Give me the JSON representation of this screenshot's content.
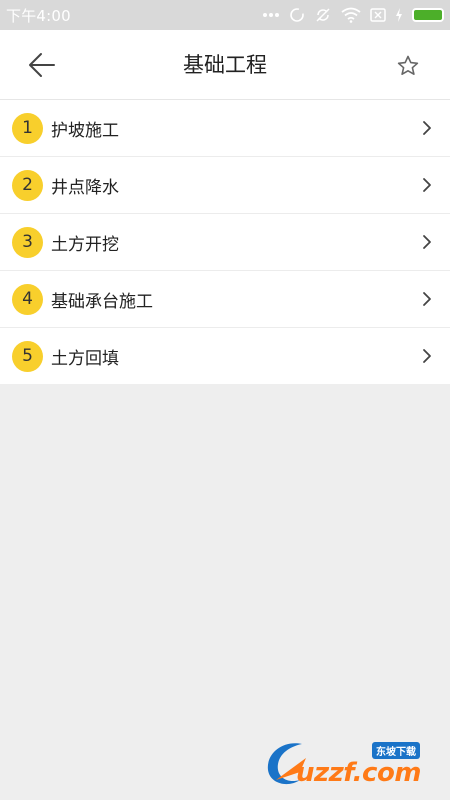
{
  "status_bar": {
    "time": "下午4:00"
  },
  "header": {
    "title": "基础工程",
    "back_icon": "arrow-left-icon",
    "favorite_icon": "star-outline-icon"
  },
  "list": {
    "items": [
      {
        "number": "1",
        "label": "护坡施工"
      },
      {
        "number": "2",
        "label": "井点降水"
      },
      {
        "number": "3",
        "label": "土方开挖"
      },
      {
        "number": "4",
        "label": "基础承台施工"
      },
      {
        "number": "5",
        "label": "土方回填"
      }
    ]
  },
  "watermark": {
    "text": "uzzf.com",
    "sub": "东坡下载"
  },
  "colors": {
    "badge": "#f8cf2c",
    "status_bar_bg": "#d9d9d9",
    "battery": "#4caf29",
    "page_bg": "#eeeeee"
  }
}
